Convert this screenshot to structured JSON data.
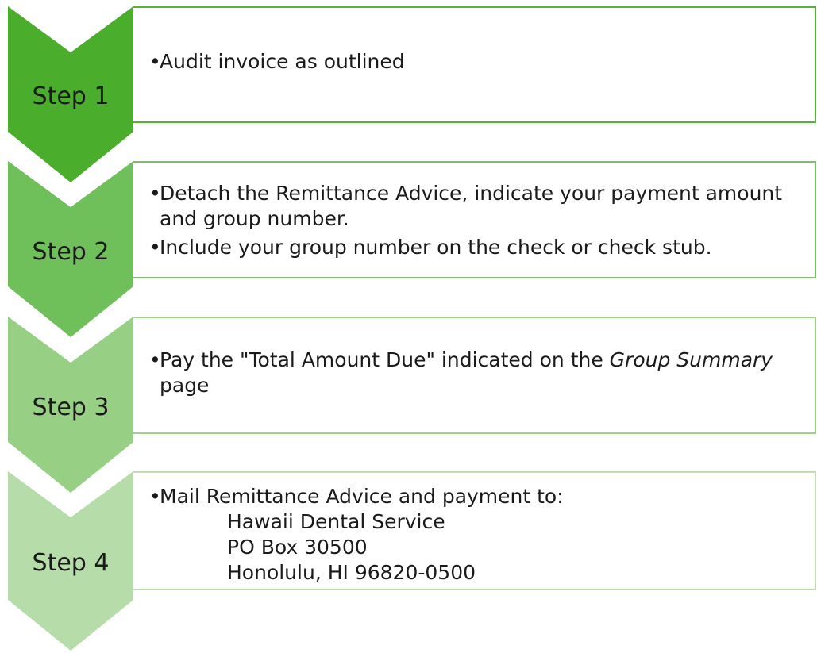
{
  "colors": {
    "step1": "#4aad2b",
    "step2": "#6fbf5b",
    "step3": "#97d084",
    "step4": "#b6dca9",
    "step1_border": "#54b438",
    "step2_border": "#76c262",
    "step3_border": "#9ed38b",
    "step4_border": "#bce0b0"
  },
  "steps": [
    {
      "label": "Step 1",
      "bullets": [
        "Audit invoice as outlined"
      ]
    },
    {
      "label": "Step 2",
      "bullets": [
        "Detach the Remittance Advice, indicate your payment amount and group number.",
        "Include your group number on the check or check stub."
      ]
    },
    {
      "label": "Step 3",
      "bullet_parts": {
        "before": "Pay the \"Total Amount Due\" indicated on the ",
        "italic": "Group Summary",
        "after": " page"
      }
    },
    {
      "label": "Step 4",
      "bullet": "Mail Remittance Advice and payment to:",
      "address": [
        "Hawaii Dental Service",
        "PO Box 30500",
        "Honolulu, HI 96820-0500"
      ]
    }
  ]
}
